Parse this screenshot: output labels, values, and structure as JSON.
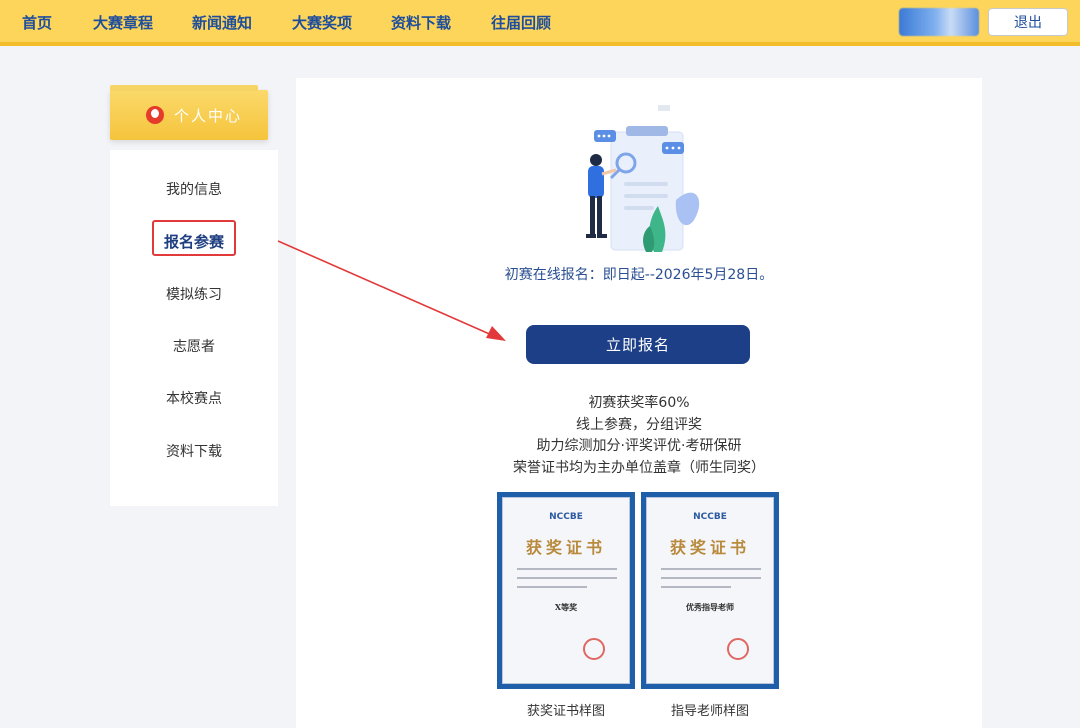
{
  "nav": {
    "items": [
      "首页",
      "大赛章程",
      "新闻通知",
      "大赛奖项",
      "资料下载",
      "往届回顾"
    ],
    "logout_label": "退出"
  },
  "sidebar": {
    "header_title": "个人中心",
    "items": [
      {
        "label": "我的信息",
        "active": false
      },
      {
        "label": "报名参赛",
        "active": true
      },
      {
        "label": "模拟练习",
        "active": false
      },
      {
        "label": "志愿者",
        "active": false
      },
      {
        "label": "本校赛点",
        "active": false
      },
      {
        "label": "资料下载",
        "active": false
      }
    ]
  },
  "main": {
    "registration_notice": "初赛在线报名：即日起--2026年5月28日。",
    "register_button": "立即报名",
    "info_lines": [
      "初赛获奖率60%",
      "线上参赛，分组评奖",
      "助力综测加分·评奖评优·考研保研",
      "荣誉证书均为主办单位盖章（师生同奖）"
    ],
    "certificates": [
      {
        "logo": "NCCBE",
        "title": "获奖证书",
        "award": "X等奖",
        "caption": "获奖证书样图"
      },
      {
        "logo": "NCCBE",
        "title": "获奖证书",
        "award": "优秀指导老师",
        "caption": "指导老师样图"
      }
    ]
  },
  "colors": {
    "nav_bg": "#fcd55a",
    "nav_text": "#1f4e9c",
    "primary_button": "#1c3f87",
    "highlight_box": "#e23a3a"
  }
}
